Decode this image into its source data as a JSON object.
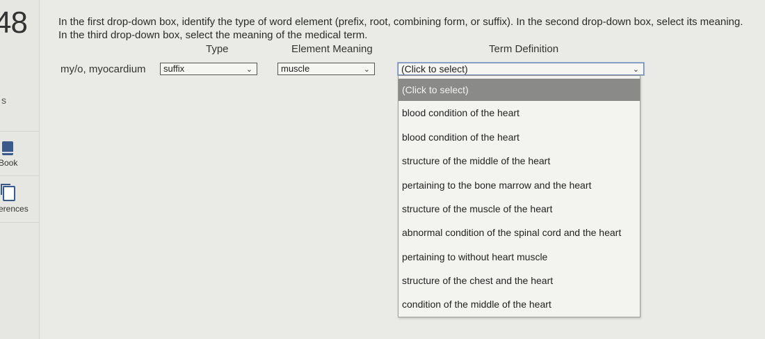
{
  "question_number": "48",
  "sidebar": {
    "partial_label": "s",
    "book_label": "Book",
    "references_label": "erences"
  },
  "instructions": "In the first drop-down box, identify the type of word element (prefix, root, combining form, or suffix). In the second drop-down box, select its meaning. In the third drop-down box, select the meaning of the medical term.",
  "columns": {
    "type": "Type",
    "element_meaning": "Element Meaning",
    "term_definition": "Term Definition"
  },
  "row": {
    "term": "my/o, myocardium",
    "type_value": "suffix",
    "meaning_value": "muscle",
    "definition_value": "(Click to select)"
  },
  "dropdown_options": [
    "(Click to select)",
    "blood condition of the heart",
    "blood condition of the heart",
    "structure of the middle of the heart",
    "pertaining to the bone marrow and the heart",
    "structure of the muscle of the heart",
    "abnormal condition of the spinal cord and the heart",
    "pertaining to without heart muscle",
    "structure of the chest and the heart",
    "condition of the middle of the heart"
  ],
  "colors": {
    "background": "#eaeae6",
    "highlight": "#8a8a88",
    "focus_border": "#6b86b5"
  }
}
